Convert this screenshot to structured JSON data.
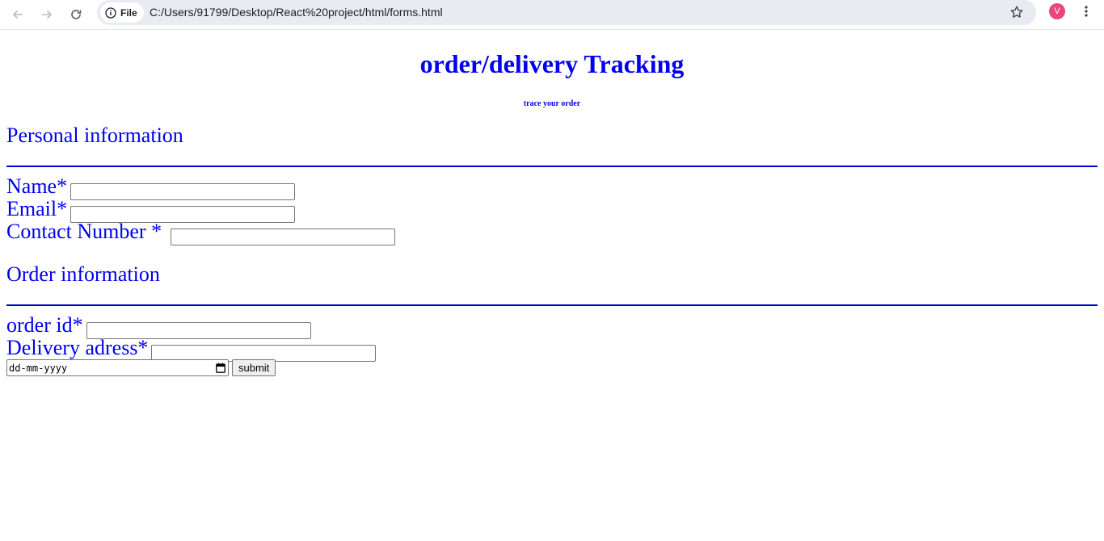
{
  "browser": {
    "site_chip_label": "File",
    "url": "C:/Users/91799/Desktop/React%20project/html/forms.html",
    "avatar_letter": "V",
    "avatar_color": "#e8467c"
  },
  "page": {
    "title": "order/delivery Tracking",
    "subtitle": "trace your order",
    "text_color": "#0000ee",
    "personal_section": {
      "heading": "Personal information",
      "fields": [
        {
          "label": "Name*",
          "value": ""
        },
        {
          "label": "Email*",
          "value": ""
        },
        {
          "label": "Contact Number *",
          "value": ""
        }
      ]
    },
    "order_section": {
      "heading": "Order information",
      "fields": [
        {
          "label": "order id*",
          "value": ""
        },
        {
          "label": "Delivery adress*",
          "value": ""
        }
      ],
      "date_placeholder": "dd-mm-yyyy",
      "submit_label": "submit"
    }
  }
}
